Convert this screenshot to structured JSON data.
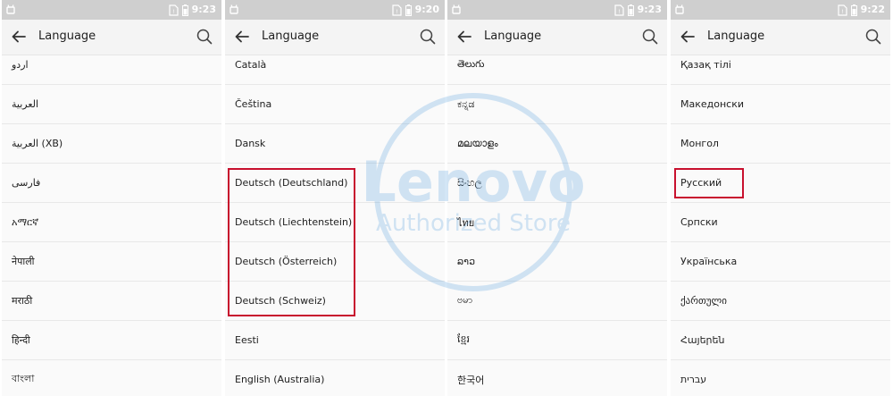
{
  "theme": {
    "accent": "#c8102e",
    "status_bar": "#cfcfcf",
    "app_bar": "#f4f4f4"
  },
  "watermark": {
    "brand": "Lenovo",
    "tagline": "Authorized Store"
  },
  "screens": [
    {
      "time": "9:23",
      "title": "Language",
      "items": [
        "اردو",
        "العربية",
        "العربية (XB)",
        "فارسی",
        "አማርኛ",
        "नेपाली",
        "मराठी",
        "हिन्दी",
        "বাংলা"
      ]
    },
    {
      "time": "9:20",
      "title": "Language",
      "items": [
        "Català",
        "Čeština",
        "Dansk",
        "Deutsch (Deutschland)",
        "Deutsch (Liechtenstein)",
        "Deutsch (Österreich)",
        "Deutsch (Schweiz)",
        "Eesti",
        "English (Australia)"
      ]
    },
    {
      "time": "9:23",
      "title": "Language",
      "items": [
        "తెలుగు",
        "ಕನ್ನಡ",
        "മലയാളം",
        "සිංහල",
        "ไทย",
        "ລາວ",
        "ဗမာ",
        "ខ្មែរ",
        "한국어"
      ]
    },
    {
      "time": "9:22",
      "title": "Language",
      "items": [
        "Қазақ тілі",
        "Македонски",
        "Монгол",
        "Русский",
        "Српски",
        "Українська",
        "ქართული",
        "Հայերեն",
        "עברית"
      ]
    }
  ]
}
